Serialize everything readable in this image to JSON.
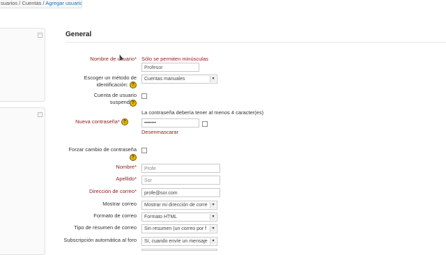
{
  "breadcrumb": {
    "items": [
      "suarios",
      "Cuentas"
    ],
    "separator": " / ",
    "current": "Agregar usuario"
  },
  "section": {
    "title": "General"
  },
  "form": {
    "username": {
      "label": "Nombre de usuario*",
      "hint": "Sólo se permiten minúsculas",
      "value": "Profesor"
    },
    "auth": {
      "label_line1": "Escoger un método de",
      "label_line2": "identificación",
      "value": "Cuentas manuales"
    },
    "suspended": {
      "label": "Cuenta de usuario suspendida"
    },
    "password": {
      "note": "La contraseña debería tener al menos 4 caracter(es)",
      "label": "Nueva contraseña*",
      "value": "••••••••",
      "unmask": "Desenmascarar"
    },
    "force_change": {
      "label": "Forzar cambio de contraseña"
    },
    "firstname": {
      "label": "Nombre*",
      "value": "Profe"
    },
    "lastname": {
      "label": "Apellido*",
      "value": "Sor"
    },
    "email": {
      "label": "Dirección de correo*",
      "value": "profe@sor.com"
    },
    "show_email": {
      "label": "Mostrar correo",
      "value": "Mostrar mi dirección de corre"
    },
    "email_format": {
      "label": "Formato de correo",
      "value": "Formato HTML"
    },
    "digest": {
      "label": "Tipo de resumen de correo",
      "value": "Sin resumen (un correo por f"
    },
    "autosubscribe": {
      "label": "Subscripción automática al foro",
      "value": "Sí, cuando envíe un mensaje"
    }
  },
  "icons": {
    "help": "help-icon",
    "collapse": "collapse-icon",
    "dropdown": "chevron-down-icon"
  },
  "colors": {
    "required": "#8a1c1c",
    "link": "#2a6ea8",
    "help": "#e3b400"
  }
}
